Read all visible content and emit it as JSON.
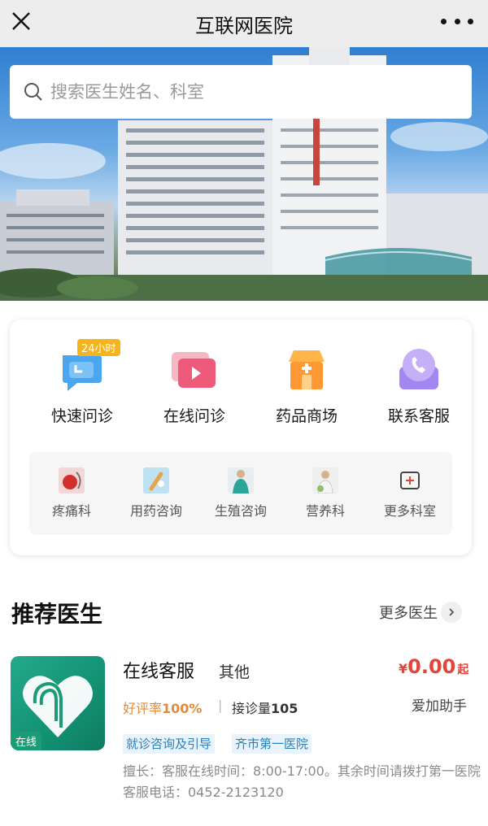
{
  "header": {
    "title": "互联网医院"
  },
  "search": {
    "placeholder": "搜索医生姓名、科室"
  },
  "main_services": [
    {
      "label": "快速问诊",
      "badge": "24小时",
      "icon": "clock-chat-icon"
    },
    {
      "label": "在线问诊",
      "icon": "video-play-icon"
    },
    {
      "label": "药品商场",
      "icon": "pharmacy-store-icon"
    },
    {
      "label": "联系客服",
      "icon": "phone-icon"
    }
  ],
  "departments": [
    {
      "label": "疼痛科",
      "icon": "pain-dept-icon"
    },
    {
      "label": "用药咨询",
      "icon": "medication-icon"
    },
    {
      "label": "生殖咨询",
      "icon": "reproductive-icon"
    },
    {
      "label": "营养科",
      "icon": "nutrition-icon"
    },
    {
      "label": "更多科室",
      "icon": "more-plus-icon"
    }
  ],
  "recommend": {
    "title": "推荐医生",
    "more_label": "更多医生",
    "doctor": {
      "avatar_tag": "在线",
      "name": "在线客服",
      "dept": "其他",
      "price_currency": "¥",
      "price": "0.00",
      "price_suffix": "起",
      "rating_label": "好评率",
      "rating_value": "100%",
      "visits_label": "接诊量",
      "visits_value": "105",
      "helper": "爱加助手",
      "tags": [
        "就诊咨询及引导",
        "齐市第一医院"
      ],
      "description": "擅长：客服在线时间：8:00-17:00。其余时间请拨打第一医院客服电话：0452-2123120"
    }
  },
  "colors": {
    "accent_red": "#e0463a",
    "rating_orange": "#e08b3e",
    "tag_blue": "#2a7fb8",
    "avatar_green": "#1c9c76"
  }
}
